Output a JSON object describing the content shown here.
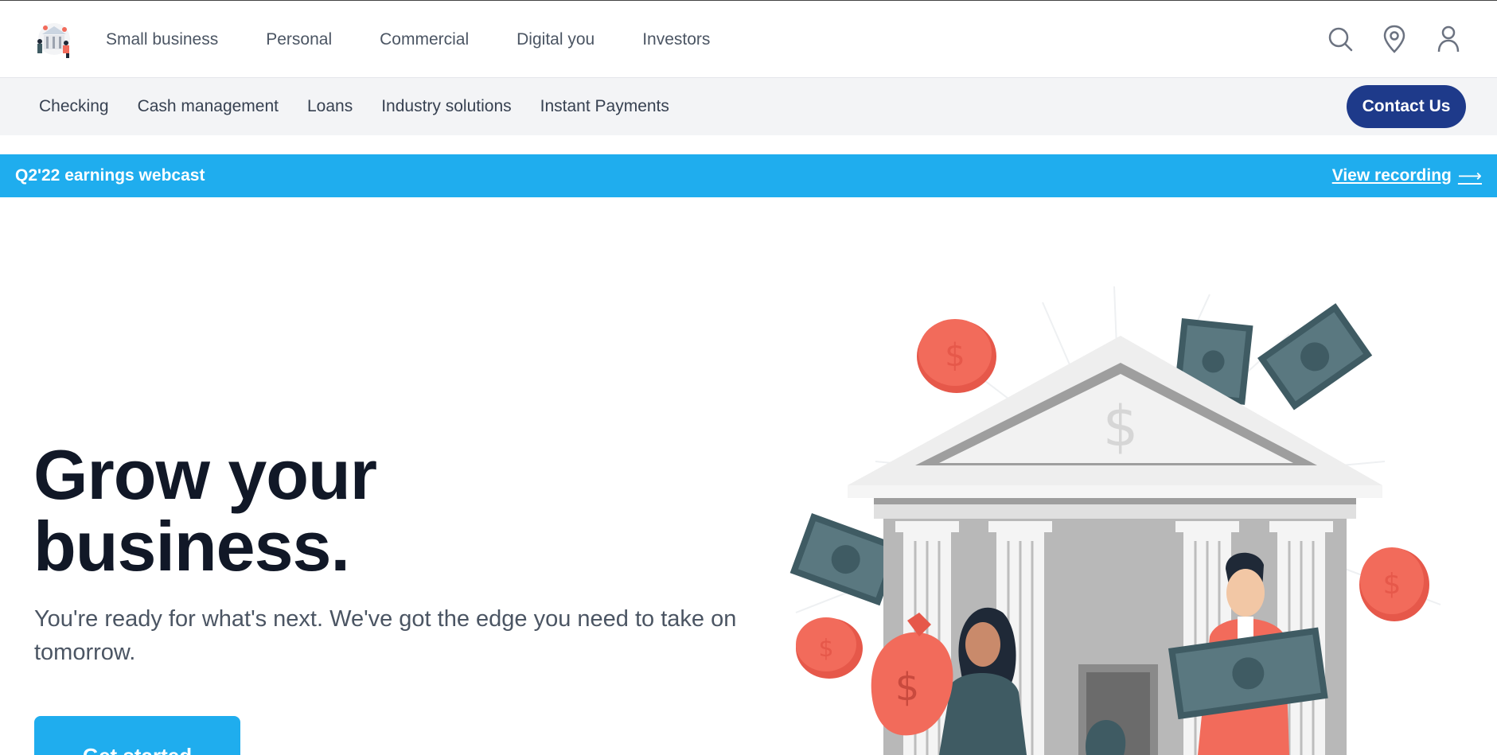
{
  "header": {
    "logo_icon": "bank-people-logo",
    "nav": [
      {
        "label": "Small business"
      },
      {
        "label": "Personal"
      },
      {
        "label": "Commercial"
      },
      {
        "label": "Digital you"
      },
      {
        "label": "Investors"
      }
    ],
    "icons": [
      "search-icon",
      "location-pin-icon",
      "user-icon"
    ]
  },
  "subnav": {
    "items": [
      {
        "label": "Checking"
      },
      {
        "label": "Cash management"
      },
      {
        "label": "Loans"
      },
      {
        "label": "Industry solutions"
      },
      {
        "label": "Instant Payments"
      }
    ],
    "contact_label": "Contact Us"
  },
  "banner": {
    "title": "Q2'22 earnings webcast",
    "link_label": "View recording",
    "arrow": "⟶"
  },
  "hero": {
    "title_line1": "Grow your",
    "title_line2": "business.",
    "subtitle": "You're ready for what's next. We've got the edge you need to take on tomorrow.",
    "cta_label": "Get started"
  },
  "colors": {
    "brand_blue": "#1fadee",
    "navy": "#1e3a8a",
    "coral": "#f26b5b",
    "slate": "#3f5b63"
  }
}
